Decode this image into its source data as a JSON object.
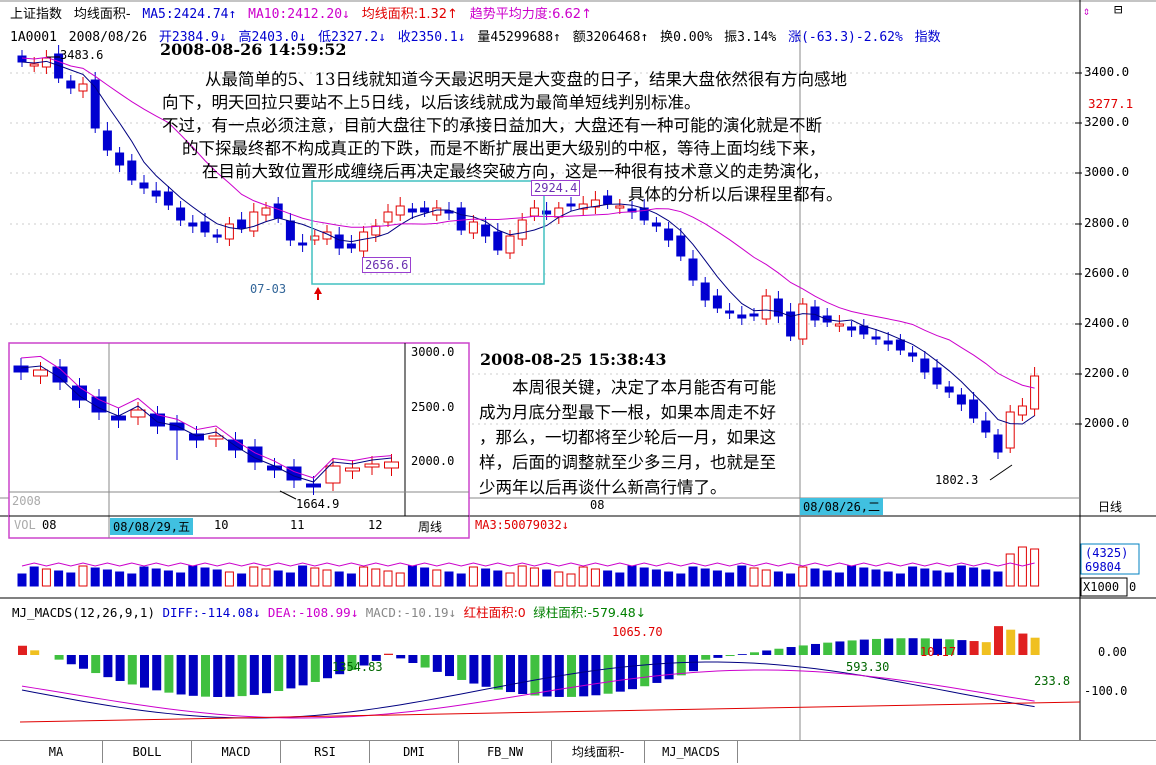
{
  "header": {
    "title": "上证指数",
    "indicator": "均线面积-",
    "ma5": "MA5:2424.74↑",
    "ma10": "MA10:2412.20↓",
    "area": "均线面积:1.32↑",
    "trend": "趋势平均力度:6.62↑"
  },
  "quote": {
    "code": "1A0001",
    "date": "2008/08/26",
    "open": "开2384.9↓",
    "high": "高2403.0↓",
    "low": "低2327.2↓",
    "close": "收2350.1↓",
    "volume": "量45299688↑",
    "amount": "额3206468↑",
    "turnover": "换0.00%",
    "amplitude": "振3.14%",
    "change": "涨(-63.3)-2.62%",
    "mode": "指数"
  },
  "annotations": {
    "timestamp1": "2008-08-26 14:59:52",
    "lines1": [
      "从最简单的5、13日线就知道今天最迟明天是大变盘的日子，结果大盘依然很有方向感地",
      "向下，明天回拉只要站不上5日线，以后该线就成为最简单短线判别标准。",
      "不过，有一点必须注意，目前大盘往下的承接日益加大，大盘还有一种可能的演化就是不断",
      "的下探最终都不构成真正的下跌，而是不断扩展出更大级别的中枢，等待上面均线下来，",
      "在目前大致位置形成缠绕后再决定最终突破方向，这是一种很有技术意义的走势演化，",
      "具体的分析以后课程里都有。"
    ],
    "timestamp2": "2008-08-25 15:38:43",
    "lines2": [
      "本周很关键，决定了本月能否有可能",
      "成为月底分型最下一根，如果本周走不好",
      "，那么，一切都将至少轮后一月，如果这",
      "样，后面的调整就至少多三月，也就是至",
      "少两年以后再谈什么新高行情了。"
    ]
  },
  "price_axis": {
    "labels": [
      "3400.0",
      "3200.0",
      "3000.0",
      "2800.0",
      "2600.0",
      "2400.0",
      "2200.0",
      "2000.0"
    ],
    "current": "3277.1"
  },
  "marks": {
    "high_left": "3483.6",
    "box_high": "2924.4",
    "box_low": "2656.6",
    "low_date": "07-03",
    "bottom_low": "1802.3",
    "cursor_date": "08/08/26,二",
    "period": "日线",
    "month_label": "08"
  },
  "inset": {
    "axis": [
      "3000.0",
      "2500.0",
      "2000.0"
    ],
    "low": "1664.9",
    "year": "2008",
    "months": [
      "08",
      "10",
      "11",
      "12"
    ],
    "cursor_date": "08/08/29,五",
    "period": "周线",
    "vol_fragment": "VOL"
  },
  "volume": {
    "ma3": "MA3:50079032↓",
    "box_value": "(4325)\n69804",
    "unit": "X1000",
    "zero": "0"
  },
  "macd": {
    "title": "MJ_MACDS(12,26,9,1)",
    "diff": "DIFF:-114.08↓",
    "dea": "DEA:-108.99↓",
    "macd": "MACD:-10.19↓",
    "red_area": "红柱面积:0",
    "green_area": "绿柱面积:-579.48↓",
    "axis": [
      "0.00",
      "-100.0"
    ],
    "values": [
      "1354.83",
      "1065.70",
      "593.30",
      "10.17",
      "233.8"
    ]
  },
  "tabs": [
    "MA",
    "BOLL",
    "MACD",
    "RSI",
    "DMI",
    "FB_NW",
    "均线面积-",
    "MJ_MACDS"
  ],
  "colors": {
    "up": "#e00000",
    "down": "#0000d0",
    "ma_short": "#000080",
    "ma_long": "#cc00cc",
    "box": "#40c0c0"
  }
}
